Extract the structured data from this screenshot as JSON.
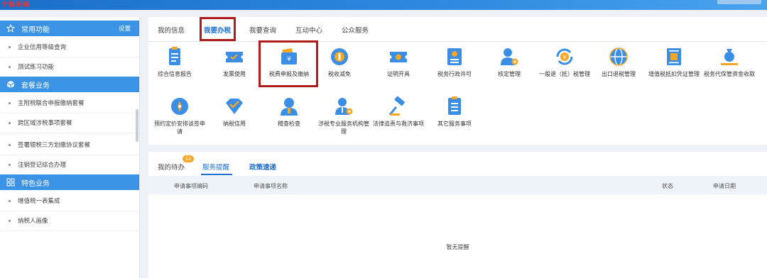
{
  "colors": {
    "accent": "#1e6fd0",
    "sidebar_header": "#3b93e6",
    "highlight": "#b01c1c",
    "badge": "#f5a623"
  },
  "top_tabs": [
    "我的信息",
    "我要办税",
    "我要查询",
    "互动中心",
    "公众服务"
  ],
  "sidebar": {
    "common": {
      "title": "常用功能",
      "setting": "设置",
      "items": [
        "企业信用等级查询",
        "测试练习功能"
      ]
    },
    "package": {
      "title": "套餐业务",
      "items": [
        "主附税联合申报缴纳套餐",
        "跨区域涉税事项套餐",
        "签署银税三方划缴协议套餐",
        "注销登记综合办理"
      ]
    },
    "special": {
      "title": "特色业务",
      "items": [
        "增值税一表集成",
        "纳税人画像"
      ]
    }
  },
  "services": [
    {
      "label": "综合信息报告",
      "icon": "report-icon"
    },
    {
      "label": "发票使用",
      "icon": "invoice-ticket-icon"
    },
    {
      "label": "税费申报及缴纳",
      "icon": "wallet-yuan-icon"
    },
    {
      "label": "税收减免",
      "icon": "coin-icon"
    },
    {
      "label": "证明开具",
      "icon": "certificate-ticket-icon"
    },
    {
      "label": "税务行政许可",
      "icon": "id-card-icon"
    },
    {
      "label": "核定管理",
      "icon": "user-gear-icon"
    },
    {
      "label": "一般退（抵）税管理",
      "icon": "refund-cycle-icon"
    },
    {
      "label": "出口退税管理",
      "icon": "globe-icon"
    },
    {
      "label": "增值税抵扣凭证管理",
      "icon": "voucher-icon"
    },
    {
      "label": "税务代保管资金收取",
      "icon": "money-bag-hand-icon"
    },
    {
      "label": "预约定价安排谈签申请",
      "icon": "compass-icon"
    },
    {
      "label": "纳税信用",
      "icon": "diamond-shield-icon"
    },
    {
      "label": "稽查检查",
      "icon": "inspector-icon"
    },
    {
      "label": "涉税专业服务机构管理",
      "icon": "agent-gear-icon"
    },
    {
      "label": "法律追责与救济事项",
      "icon": "gavel-icon"
    },
    {
      "label": "其它服务事项",
      "icon": "list-doc-icon"
    }
  ],
  "bottom_tabs": {
    "todo": "我的待办",
    "todo_count": "52",
    "reminders": "服务提醒",
    "policy": "政策速递"
  },
  "table": {
    "headers": [
      "申请事项编码",
      "申请事项名称",
      "状态",
      "申请日期"
    ],
    "empty": "暂无提醒"
  },
  "logo_text": "个税系统"
}
